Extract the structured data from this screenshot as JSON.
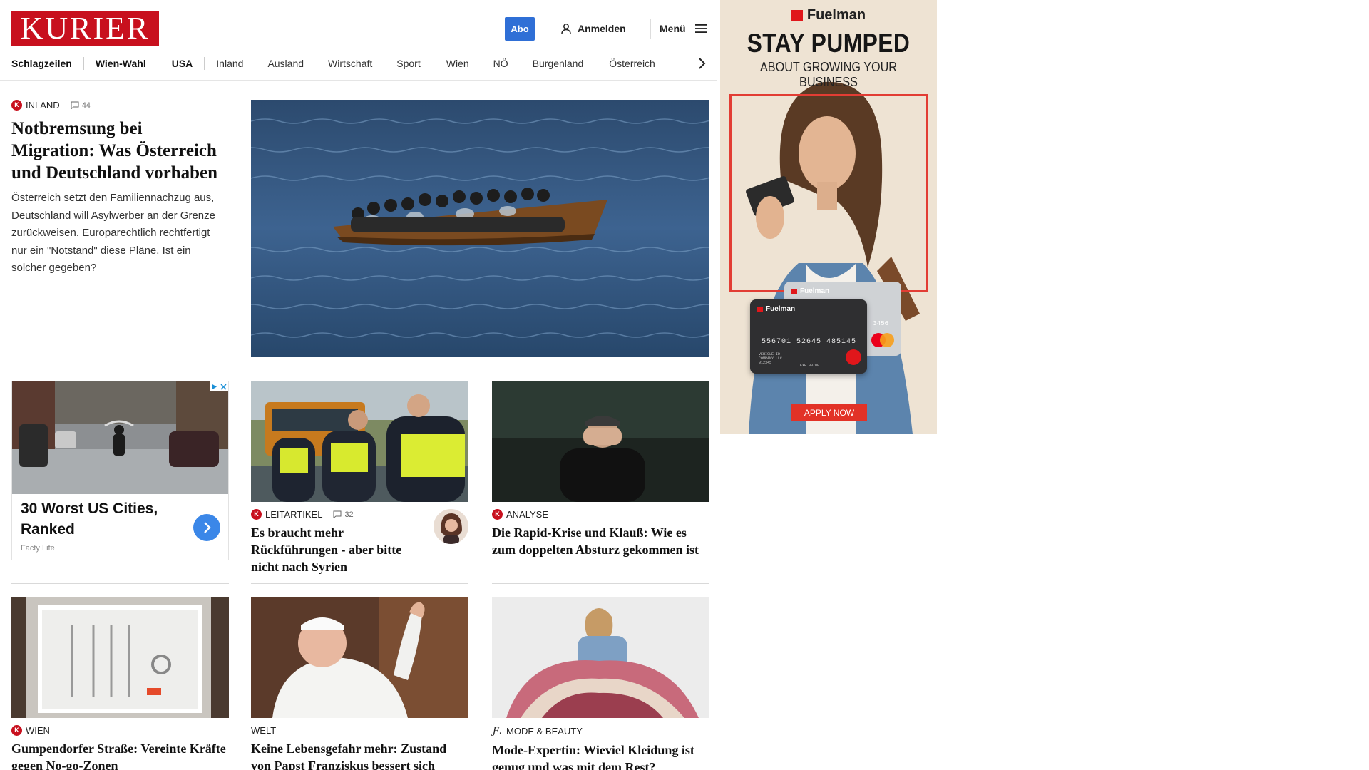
{
  "header": {
    "logo": "KURIER",
    "abo_label": "Abo",
    "login_label": "Anmelden",
    "menu_label": "Menü"
  },
  "nav": {
    "items": [
      "Schlagzeilen",
      "Wien-Wahl",
      "USA",
      "Inland",
      "Ausland",
      "Wirtschaft",
      "Sport",
      "Wien",
      "NÖ",
      "Burgenland",
      "Österreich"
    ]
  },
  "hero": {
    "category": "INLAND",
    "comments": "44",
    "title": "Notbremsung bei Migration: Was Österreich und Deutschland vorhaben",
    "lead": "Österreich setzt den Familiennachzug aus, Deutschland will Asylwerber an der Grenze zurückweisen. Europarechtlich rechtfertigt nur ein \"Notstand\" diese Pläne. Ist ein solcher gegeben?"
  },
  "sponsored": {
    "title": "30 Worst US Cities, Ranked",
    "source": "Facty Life"
  },
  "articles": [
    {
      "category": "LEITARTIKEL",
      "comments": "32",
      "title": "Es braucht mehr Rückführungen - aber bitte nicht nach Syrien"
    },
    {
      "category": "ANALYSE",
      "title": "Die Rapid-Krise und Klauß: Wie es zum doppelten Absturz gekommen ist"
    },
    {
      "category": "WIEN",
      "title": "Gumpendorfer Straße: Vereinte Kräfte gegen No-go-Zonen"
    },
    {
      "category": "WELT",
      "title": "Keine Lebensgefahr mehr: Zustand von Papst Franziskus bessert sich"
    },
    {
      "category": "MODE & BEAUTY",
      "title": "Mode-Expertin: Wieviel Kleidung ist genug und was mit dem Rest?"
    }
  ],
  "ad": {
    "brand": "Fuelman",
    "headline": "STAY PUMPED",
    "subline": "ABOUT GROWING YOUR BUSINESS",
    "cta": "APPLY NOW",
    "card_number": "556701 52645 485145",
    "card_extra": "3456",
    "card_line1": "VEHICLE ID",
    "card_line2": "COMPANY LLC",
    "card_line3": "012345",
    "card_exp": "EXP 00/00"
  }
}
